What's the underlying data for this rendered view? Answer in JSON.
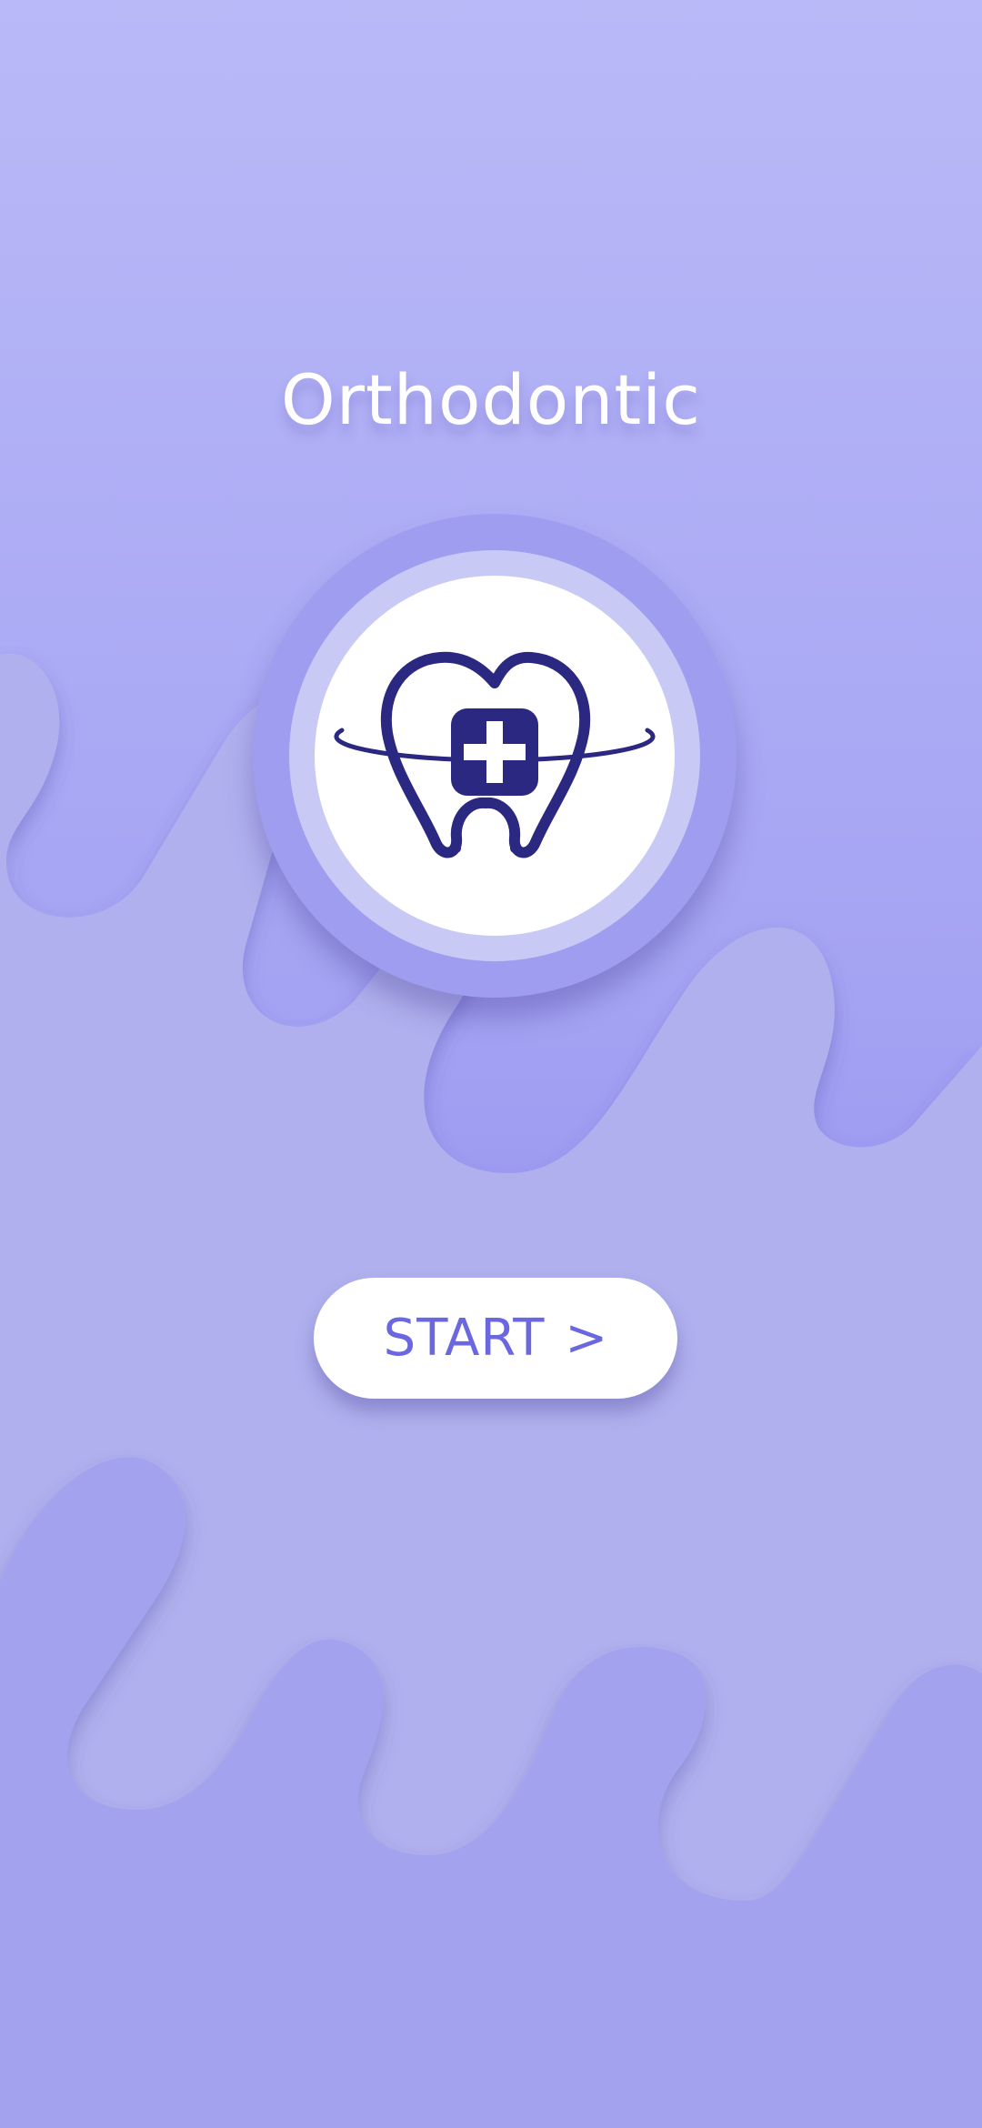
{
  "app": {
    "title": "Orthodontic"
  },
  "logo": {
    "icon": "tooth-heart-medical-cross-icon"
  },
  "start_button": {
    "label": "START",
    "chevron": ">"
  },
  "colors": {
    "accent": "#6a67e0",
    "logo_navy": "#2a2880",
    "bg_top": "#b9b9f8",
    "bg_bottom": "#6b69e8"
  }
}
